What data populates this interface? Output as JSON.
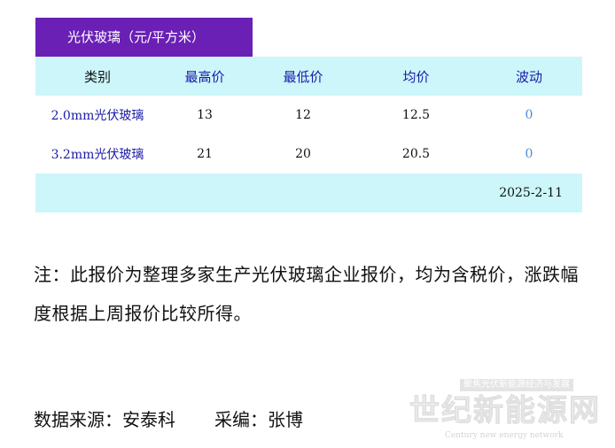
{
  "table_title": "光伏玻璃（元/平方米）",
  "columns": [
    "类别",
    "最高价",
    "最低价",
    "均价",
    "波动"
  ],
  "rows": [
    {
      "category": "2.0mm光伏玻璃",
      "high": "13",
      "low": "12",
      "avg": "12.5",
      "change": "0"
    },
    {
      "category": "3.2mm光伏玻璃",
      "high": "21",
      "low": "20",
      "avg": "20.5",
      "change": "0"
    }
  ],
  "date": "2025-2-11",
  "note": "注：此报价为整理多家生产光伏玻璃企业报价，均为含税价，涨跌幅度根据上周报价比较所得。",
  "source": "数据来源：安泰科",
  "editor": "采编：张博",
  "watermark": {
    "tag": "聚焦光伏新能源经济与发展",
    "main": "世纪新能源网",
    "sub": "Century new energy network"
  },
  "colors": {
    "title_bg": "#6a1fb5",
    "header_bg": "#ccf6fa",
    "header_text": "#1a1aa8",
    "change_text": "#4a8ad6"
  }
}
